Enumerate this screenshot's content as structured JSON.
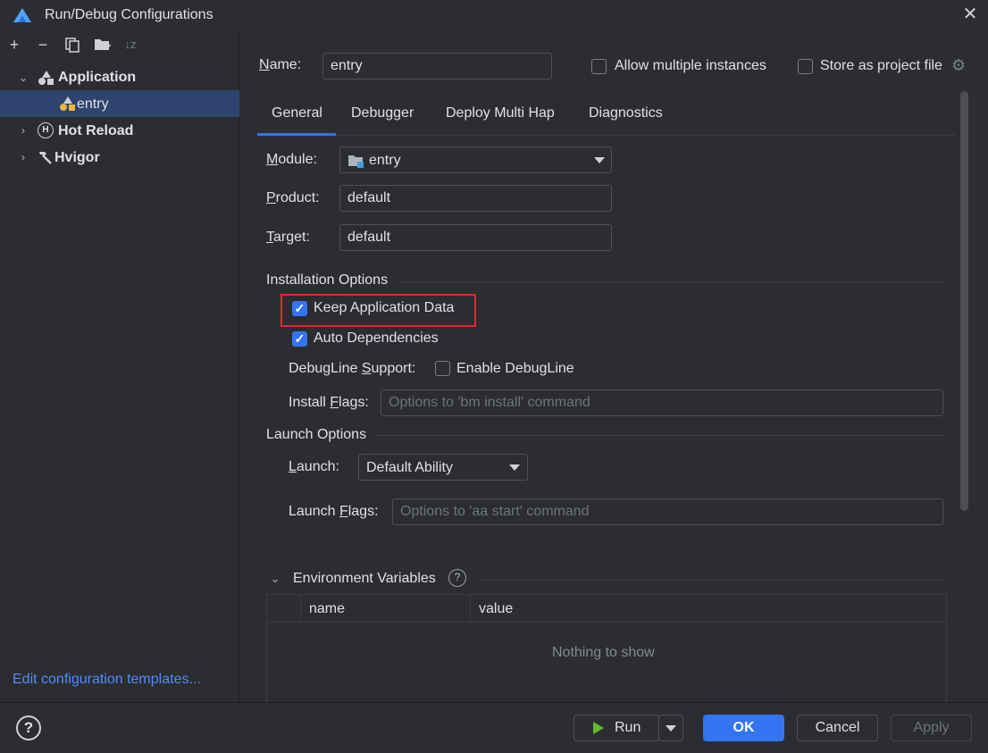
{
  "window": {
    "title": "Run/Debug Configurations"
  },
  "toolbar": {
    "add": "+",
    "remove": "−",
    "sort": "↓z"
  },
  "tree": {
    "application": "Application",
    "entry": "entry",
    "hot_reload": "Hot Reload",
    "hvigor": "Hvigor"
  },
  "left_footer": {
    "edit_templates": "Edit configuration templates..."
  },
  "header": {
    "name_label": "Name:",
    "name_value": "entry",
    "allow_multiple": "Allow multiple instances",
    "store_project": "Store as project file"
  },
  "tabs": [
    "General",
    "Debugger",
    "Deploy Multi Hap",
    "Diagnostics"
  ],
  "general": {
    "module_label": "Module:",
    "module_value": "entry",
    "product_label": "Product:",
    "product_value": "default",
    "target_label": "Target:",
    "target_value": "default",
    "installation_options": "Installation Options",
    "keep_app_data": "Keep Application Data",
    "auto_dependencies": "Auto Dependencies",
    "debugline_label": "DebugLine Support:",
    "enable_debugline": "Enable DebugLine",
    "install_flags_label": "Install Flags:",
    "install_flags_placeholder": "Options to 'bm install' command",
    "launch_options": "Launch Options",
    "launch_label": "Launch:",
    "launch_value": "Default Ability",
    "launch_flags_label": "Launch Flags:",
    "launch_flags_placeholder": "Options to 'aa start' command",
    "env_vars": "Environment Variables",
    "col_name": "name",
    "col_value": "value",
    "empty": "Nothing to show"
  },
  "footer": {
    "help": "?",
    "run": "Run",
    "ok": "OK",
    "cancel": "Cancel",
    "apply": "Apply"
  },
  "state": {
    "keep_app_data_checked": true,
    "auto_dependencies_checked": true,
    "enable_debugline_checked": false,
    "allow_multiple_checked": false,
    "store_project_checked": false
  },
  "colors": {
    "accent": "#3574f0",
    "highlight": "#e0282e",
    "selection": "#2e436e",
    "run_green": "#5fb832"
  }
}
